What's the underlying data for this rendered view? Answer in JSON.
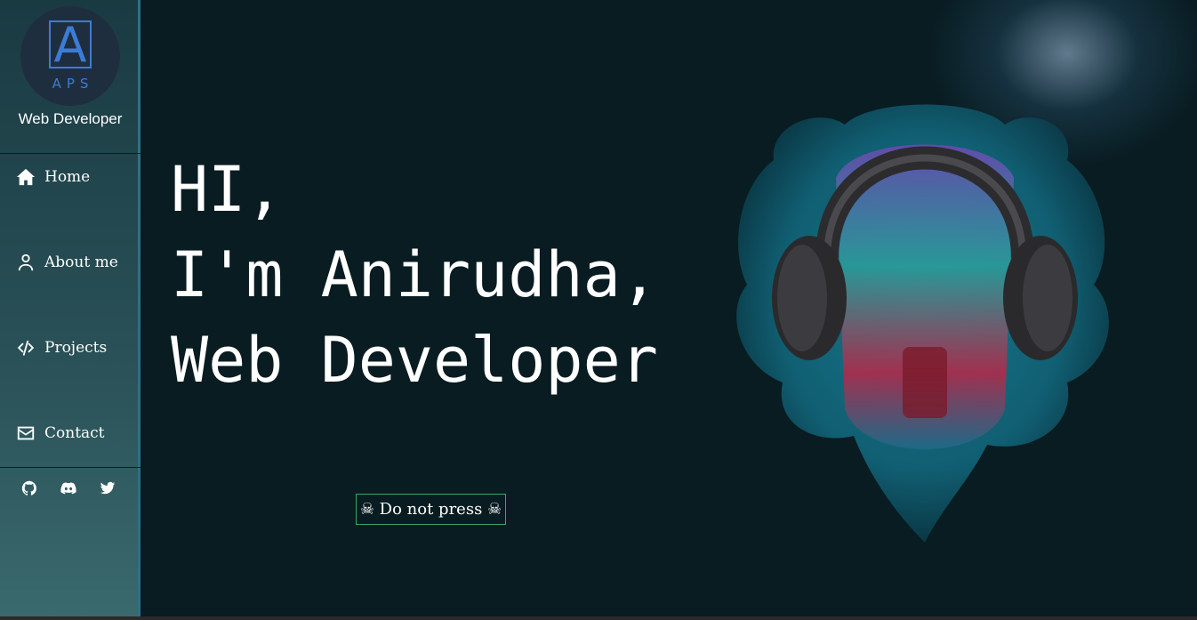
{
  "logo": {
    "letter": "A",
    "subtitle": "APS"
  },
  "sidebar": {
    "role": "Web Developer",
    "nav": [
      {
        "label": "Home",
        "icon": "home-icon"
      },
      {
        "label": "About me",
        "icon": "user-icon"
      },
      {
        "label": "Projects",
        "icon": "code-icon"
      },
      {
        "label": "Contact",
        "icon": "envelope-icon"
      }
    ],
    "socials": [
      "github-icon",
      "discord-icon",
      "twitter-icon"
    ]
  },
  "hero": {
    "line1": "HI,",
    "line2": "I'm Anirudha,",
    "line3": "Web Developer"
  },
  "button": {
    "label": "☠ Do not press ☠"
  },
  "colors": {
    "background": "#081c21",
    "sidebar_top": "#1a3a42",
    "sidebar_bottom": "#3a6a6e",
    "logo_accent": "#3c7bd6",
    "button_border": "#3aa86a",
    "text": "#ffffff"
  }
}
